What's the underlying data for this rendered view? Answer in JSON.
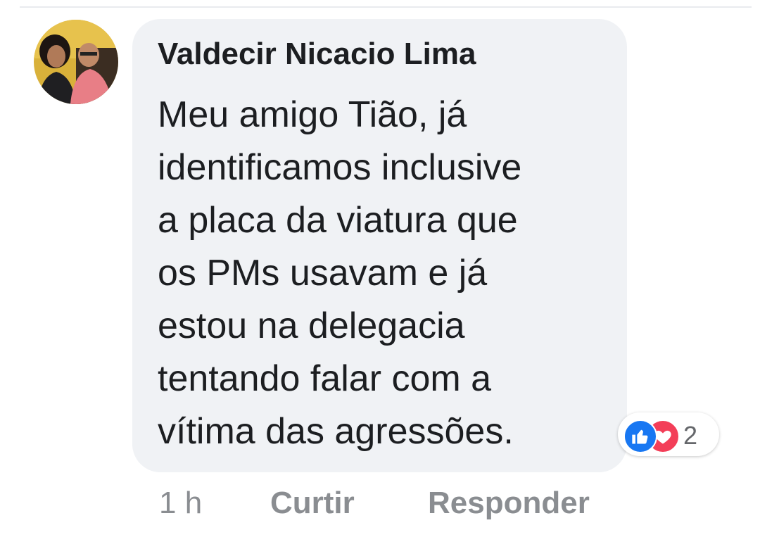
{
  "comment": {
    "author": "Valdecir Nicacio Lima",
    "text_lines": [
      "Meu amigo Tião, já",
      "identificamos inclusive",
      "a placa da viatura que",
      "os PMs usavam e já",
      "estou na delegacia",
      "tentando falar com a",
      "vítima das agressões."
    ],
    "timestamp": "1 h",
    "like_label": "Curtir",
    "reply_label": "Responder",
    "reactions": {
      "types": [
        "like-icon",
        "love-icon"
      ],
      "count": "2"
    }
  },
  "colors": {
    "bubble": "#f0f2f5",
    "like": "#1877f2",
    "love": "#f33e58",
    "meta_text": "#8a8d91"
  }
}
